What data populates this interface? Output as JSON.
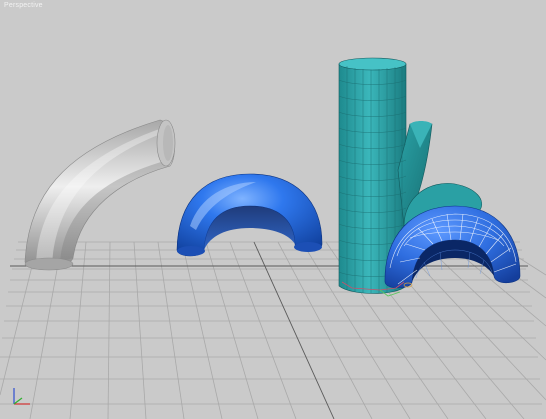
{
  "viewport": {
    "label": "Perspective",
    "background": "#cacaca",
    "grid_color": "#a9a9a9",
    "grid_axis_color": "#5a5a5a"
  },
  "objects": [
    {
      "name": "gray-tube-elbow",
      "color": "#b8b8b8"
    },
    {
      "name": "blue-half-torus",
      "color": "#2a6ad8"
    },
    {
      "name": "teal-cylinder-branch",
      "color": "#28a2a8"
    },
    {
      "name": "blue-wireframe-half-torus",
      "color": "#2f6ee0"
    }
  ],
  "axis_tripod": {
    "x_color": "#d03030",
    "y_color": "#30b030",
    "z_color": "#3050d0"
  }
}
